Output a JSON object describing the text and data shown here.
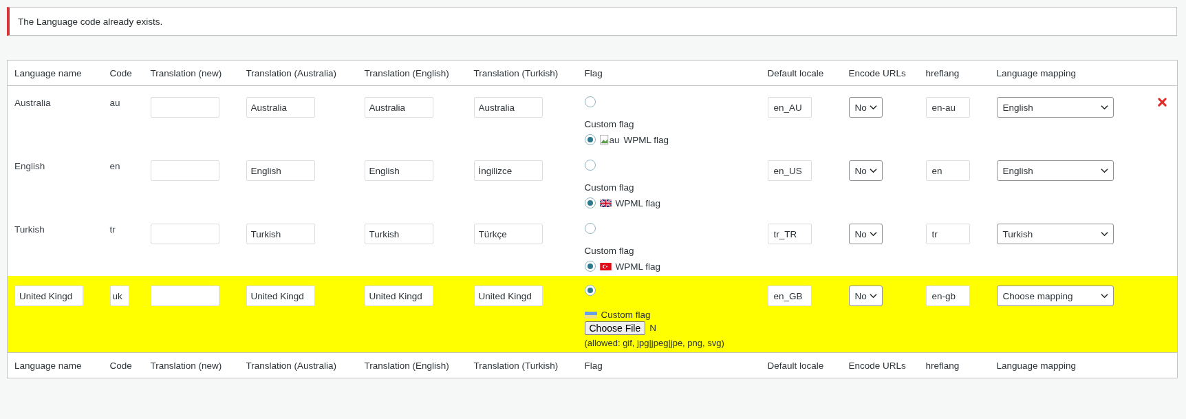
{
  "notice": {
    "text": "The Language code already exists."
  },
  "columns": [
    "Language name",
    "Code",
    "Translation (new)",
    "Translation (Australia)",
    "Translation (English)",
    "Translation (Turkish)",
    "Flag",
    "Default locale",
    "Encode URLs",
    "hreflang",
    "Language mapping"
  ],
  "rows": [
    {
      "editable": false,
      "highlighted": false,
      "name": "Australia",
      "code": "au",
      "translations": [
        "Australia",
        "Australia",
        "Australia"
      ],
      "flag": {
        "kind": "wpml",
        "top_selected": false,
        "custom_label": "Custom flag",
        "wpml": {
          "kind": "broken",
          "selected": true,
          "alt": "au",
          "label": "WPML flag"
        }
      },
      "locale": "en_AU",
      "encode": "No",
      "hreflang": "en-au",
      "mapping": "English",
      "deletable": true
    },
    {
      "editable": false,
      "highlighted": false,
      "name": "English",
      "code": "en",
      "translations": [
        "English",
        "English",
        "İngilizce"
      ],
      "flag": {
        "kind": "wpml",
        "top_selected": false,
        "custom_label": "Custom flag",
        "wpml": {
          "kind": "uk",
          "selected": true,
          "label": "WPML flag"
        }
      },
      "locale": "en_US",
      "encode": "No",
      "hreflang": "en",
      "mapping": "English",
      "deletable": false
    },
    {
      "editable": false,
      "highlighted": false,
      "name": "Turkish",
      "code": "tr",
      "translations": [
        "Turkish",
        "Turkish",
        "Türkçe"
      ],
      "flag": {
        "kind": "wpml",
        "top_selected": false,
        "custom_label": "Custom flag",
        "wpml": {
          "kind": "tr",
          "selected": true,
          "label": "WPML flag"
        }
      },
      "locale": "tr_TR",
      "encode": "No",
      "hreflang": "tr",
      "mapping": "Turkish",
      "deletable": false
    },
    {
      "editable": true,
      "highlighted": true,
      "name": "United Kingd",
      "code": "uk",
      "translations": [
        "United Kingd",
        "United Kingd",
        "United Kingd"
      ],
      "flag": {
        "kind": "upload",
        "top_selected": true,
        "custom_label": "Custom flag",
        "file_button": "Choose File",
        "file_status": "N",
        "allowed": "(allowed: gif, jpg|jpeg|jpe, png, svg)"
      },
      "locale": "en_GB",
      "encode": "No",
      "hreflang": "en-gb",
      "mapping": "Choose mapping",
      "deletable": false
    }
  ],
  "footer_columns": [
    "Language name",
    "Code",
    "Translation (new)",
    "Translation (Australia)",
    "Translation (English)",
    "Translation (Turkish)",
    "Flag",
    "Default locale",
    "Encode URLs",
    "hreflang",
    "Language mapping"
  ]
}
